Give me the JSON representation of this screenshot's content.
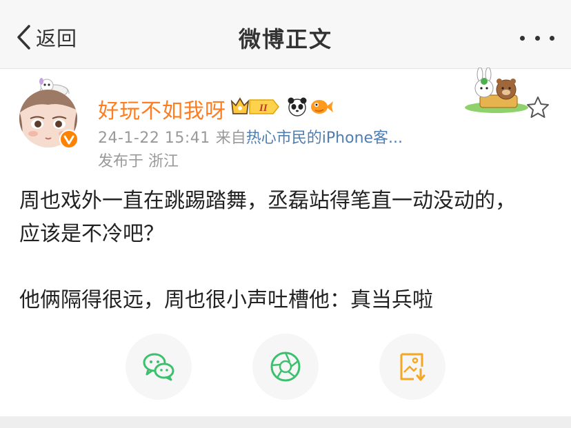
{
  "nav": {
    "back_label": "返回",
    "title": "微博正文",
    "more_icon": "ellipsis-icon"
  },
  "post": {
    "author": "好玩不如我呀",
    "level_badge": "II",
    "time": "24-1-22 15:41",
    "from_prefix": "来自",
    "source": "热心市民的iPhone客...",
    "location": "发布于 浙江",
    "paragraphs": [
      "周也戏外一直在跳踢踏舞，丞磊站得笔直一动没动的，应该是不冷吧？",
      "他俩隔得很远，周也很小声吐槽他：真当兵啦"
    ]
  },
  "share_actions": [
    {
      "icon": "wechat-icon",
      "color": "#3cc06d"
    },
    {
      "icon": "moments-aperture-icon",
      "color": "#3cc06d"
    },
    {
      "icon": "save-image-icon",
      "color": "#f5a623"
    }
  ],
  "colors": {
    "username": "#ff7d1f",
    "link": "#507daf",
    "meta": "#999999",
    "navbar": "#f7f7f7"
  }
}
